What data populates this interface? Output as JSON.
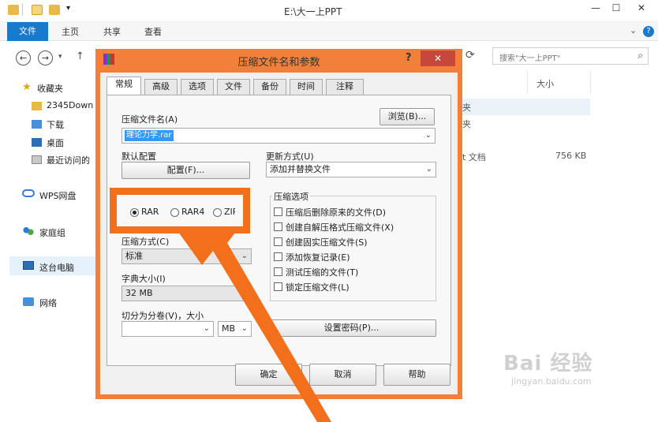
{
  "window": {
    "title": "E:\\大一上PPT"
  },
  "ribbon": {
    "tabs": [
      "文件",
      "主页",
      "共享",
      "查看"
    ]
  },
  "search": {
    "placeholder": "搜索\"大一上PPT\""
  },
  "sidebar": {
    "items": [
      {
        "label": "收藏夹",
        "icon": "star-icon"
      },
      {
        "label": "2345Down",
        "icon": "folder-icon"
      },
      {
        "label": "下载",
        "icon": "download-folder-icon"
      },
      {
        "label": "桌面",
        "icon": "desktop-icon"
      },
      {
        "label": "最近访问的",
        "icon": "recent-places-icon"
      },
      {
        "label": "WPS网盘",
        "icon": "cloud-icon"
      },
      {
        "label": "家庭组",
        "icon": "homegroup-icon"
      },
      {
        "label": "这台电脑",
        "icon": "computer-icon"
      },
      {
        "label": "网络",
        "icon": "network-icon"
      }
    ]
  },
  "content": {
    "size_header": "大小",
    "rows": [
      {
        "type": "夹",
        "size": ""
      },
      {
        "type": "夹",
        "size": ""
      },
      {
        "type": "t 文档",
        "size": "756 KB"
      }
    ]
  },
  "dialog": {
    "title": "压缩文件名和参数",
    "help": "?",
    "close": "✕",
    "tabs": [
      "常规",
      "高级",
      "选项",
      "文件",
      "备份",
      "时间",
      "注释"
    ],
    "archive_name_label": "压缩文件名(A)",
    "browse_button": "浏览(B)...",
    "archive_name_value": "理论力学.rar",
    "default_profile_label": "默认配置",
    "profile_button": "配置(F)...",
    "update_mode_label": "更新方式(U)",
    "update_mode_value": "添加并替换文件",
    "format_options": [
      "RAR",
      "RAR4",
      "ZIP"
    ],
    "format_selected": "RAR",
    "method_label": "压缩方式(C)",
    "method_value": "标准",
    "dict_label": "字典大小(I)",
    "dict_value": "32 MB",
    "split_label": "切分为分卷(V)，大小",
    "split_unit": "MB",
    "options_group_label": "压缩选项",
    "options": [
      "压缩后删除原来的文件(D)",
      "创建自解压格式压缩文件(X)",
      "创建固实压缩文件(S)",
      "添加恢复记录(E)",
      "测试压缩的文件(T)",
      "锁定压缩文件(L)"
    ],
    "password_button": "设置密码(P)...",
    "ok_button": "确定",
    "cancel_button": "取消",
    "help_button": "帮助"
  },
  "watermark": {
    "brand": "Bai 经验",
    "url": "jingyan.baidu.com"
  },
  "colors": {
    "accent_orange": "#f26f1c",
    "ribbon_blue": "#1979ca",
    "dialog_frame": "#f2803a"
  }
}
